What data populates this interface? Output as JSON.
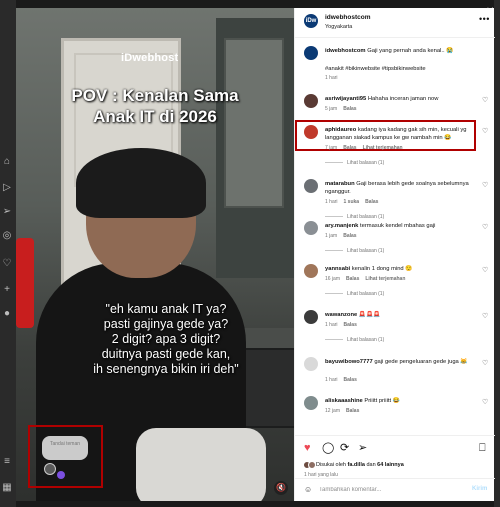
{
  "post": {
    "account": "idwebhostcom",
    "location": "Yogyakarta",
    "avatar_text": "iDw",
    "brand_overlay": "iDwebhost",
    "pov_line1": "POV : Kenalan Sama",
    "pov_line2": "Anak IT di 2026",
    "caption_overlay": "\"eh kamu anak IT ya?\npasti gajinya gede ya?\n2 digit? apa 3 digit?\nduitnya pasti gede kan,\nih senengnya bikin iri deh\"",
    "tag_hint": "Tandai teman",
    "caption": {
      "author": "idwebhostcom",
      "text": "Gaji yang pernah anda kenal.. 😭",
      "hashtags": "#anakit #bikinwebsite #tipsbikinwebsite",
      "time": "1 hari"
    }
  },
  "comments": [
    {
      "author": "asriwijayanti95",
      "text": "Hahaha inceran jaman now",
      "time": "5 jam",
      "reply": "Balas",
      "extra": "",
      "likes": "",
      "replies": "",
      "avatar_color": "#5a3a34"
    },
    {
      "author": "aphidaureo",
      "text": "kadang iya kadang gak sih min, kecuali yg langganan siakad kampus ke gw nambah min 😂",
      "time": "7 jam",
      "reply": "Balas",
      "extra": "Lihat terjemahan",
      "likes": "",
      "replies": "Lihat balasan (1)",
      "avatar_color": "#c0392b"
    },
    {
      "author": "matarabun",
      "text": "Gaji berasa lebih gede soalnya sebelumnya nganggur.",
      "time": "1 hari",
      "reply": "Balas",
      "extra": "",
      "likes": "1 suka",
      "replies": "Lihat balasan (1)",
      "avatar_color": "#6b6f74"
    },
    {
      "author": "ary.manjenk",
      "text": "termasuk kendel mbahas gaji",
      "time": "1 jam",
      "reply": "Balas",
      "extra": "",
      "likes": "",
      "replies": "Lihat balasan (1)",
      "avatar_color": "#8a8f94"
    },
    {
      "author": "yannsabi",
      "text": "kenalin 1 dong mind 😌",
      "time": "16 jam",
      "reply": "Balas",
      "extra": "Lihat terjemahan",
      "likes": "",
      "replies": "Lihat balasan (1)",
      "avatar_color": "#a0765a"
    },
    {
      "author": "wawanzone",
      "text": "🚨🚨🚨",
      "time": "1 hari",
      "reply": "Balas",
      "extra": "",
      "likes": "",
      "replies": "Lihat balasan (1)",
      "avatar_color": "#3b3b3b"
    },
    {
      "author": "bayuwibowo7777",
      "text": "gaji gede pengeluaran gede juga 😹",
      "time": "1 hari",
      "reply": "Balas",
      "extra": "",
      "likes": "",
      "replies": "",
      "avatar_color": "#d9d9d9"
    },
    {
      "author": "aliskaaashine",
      "text": "Priiitt priiitt 😂",
      "time": "12 jam",
      "reply": "Balas",
      "extra": "",
      "likes": "",
      "replies": "",
      "avatar_color": "#7f8c8d"
    }
  ],
  "actions": {
    "liked_by_prefix": "Disukai oleh",
    "liked_by_user": "fa.dilla",
    "liked_by_mid": "dan",
    "liked_by_rest": "64 lainnya",
    "posted_ago": "1 hari yang lalu"
  },
  "composer": {
    "placeholder": "Tambahkan komentar...",
    "post_label": "Kirim"
  },
  "colors": {
    "highlight": "#b00000",
    "like_red": "#ed4956",
    "link_blue": "#00376b"
  }
}
